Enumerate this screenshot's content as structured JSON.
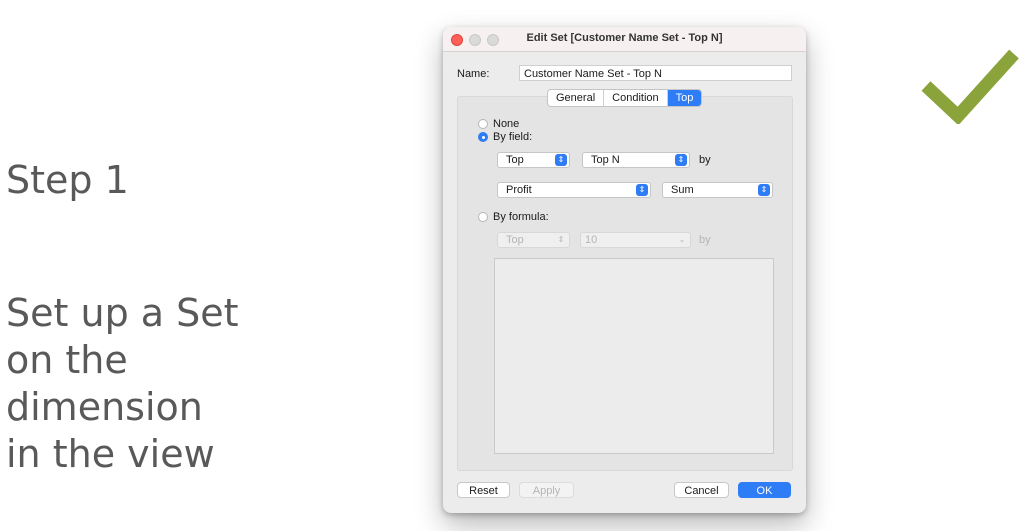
{
  "slide": {
    "step": "Step 1",
    "description_lines": [
      "Set up a Set",
      "on the",
      "dimension",
      "in the view"
    ]
  },
  "dialog": {
    "title": "Edit Set [Customer Name Set - Top N]",
    "name_label": "Name:",
    "name_value": "Customer Name Set - Top N",
    "tabs": [
      {
        "label": "General",
        "active": false
      },
      {
        "label": "Condition",
        "active": false
      },
      {
        "label": "Top",
        "active": true
      }
    ],
    "options": {
      "none": "None",
      "by_field": "By field:",
      "by_formula": "By formula:"
    },
    "by_field": {
      "direction": "Top",
      "count": "Top N",
      "by_label": "by",
      "field": "Profit",
      "aggregation": "Sum"
    },
    "by_formula": {
      "direction": "Top",
      "count": "10",
      "by_label": "by"
    },
    "buttons": {
      "reset": "Reset",
      "apply": "Apply",
      "cancel": "Cancel",
      "ok": "OK"
    }
  },
  "colors": {
    "accent": "#2f7df6",
    "checkmark": "#8aa33a",
    "slide_text": "#595959"
  },
  "icons": {
    "checkmark": "checkmark-icon"
  }
}
